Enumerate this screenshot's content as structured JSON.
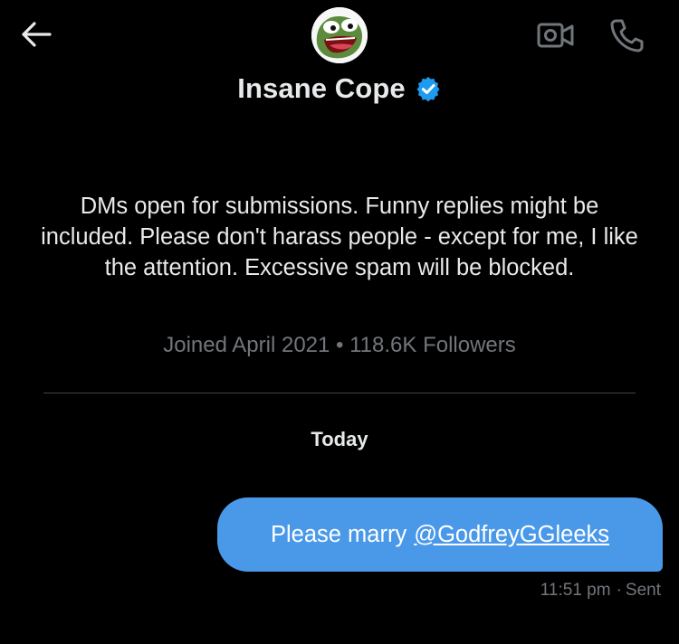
{
  "header": {
    "back_icon": "arrow-left-icon",
    "video_icon": "video-call-icon",
    "phone_icon": "phone-call-icon"
  },
  "profile": {
    "name": "Insane Cope",
    "verified_icon": "verified-badge-icon",
    "verified_color": "#1d9bf0",
    "bio": "DMs open for submissions. Funny replies might be included. Please don't harass people - except for me, I like the attention. Excessive spam will be blocked.",
    "joined": "Joined April 2021",
    "separator": "•",
    "followers": "118.6K Followers"
  },
  "conversation": {
    "date_label": "Today",
    "messages": [
      {
        "text": "Please marry",
        "mention": "@GodfreyGGleeks",
        "time": "11:51 pm",
        "status_separator": "·",
        "status": "Sent",
        "bubble_color": "#4a99e9"
      }
    ]
  },
  "colors": {
    "background": "#000000",
    "text_primary": "#e7e9ea",
    "text_secondary": "#71767b"
  }
}
